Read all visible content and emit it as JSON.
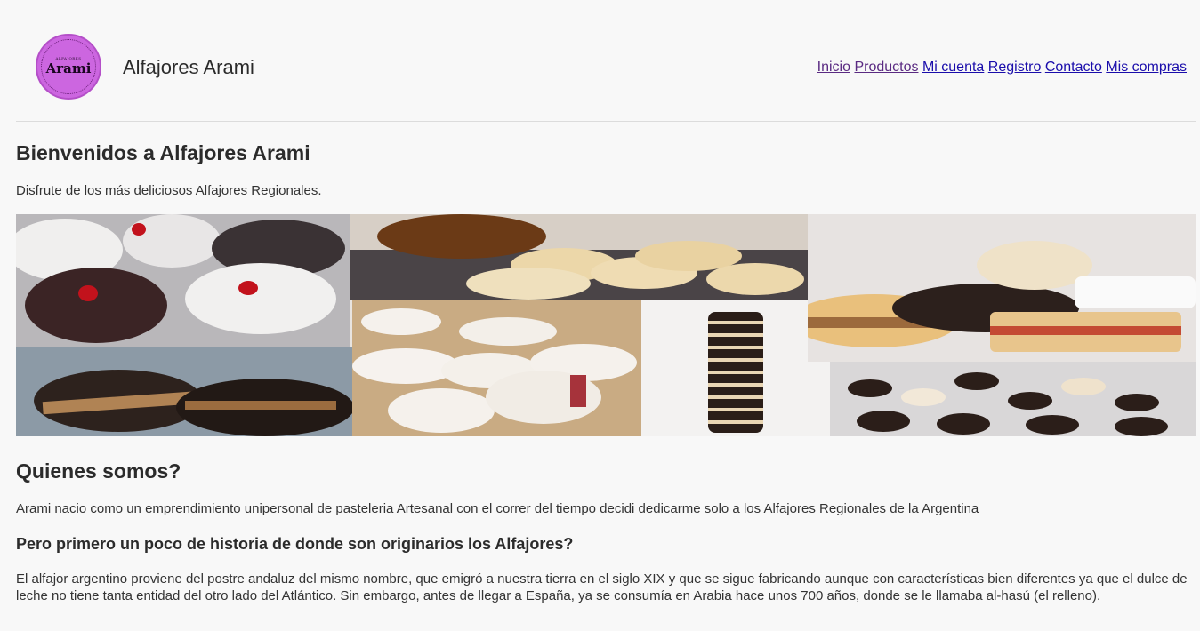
{
  "header": {
    "logo": {
      "small_text": "ALFAJORES",
      "word": "Arami"
    },
    "site_title": "Alfajores Arami",
    "nav": [
      {
        "label": "Inicio"
      },
      {
        "label": "Productos"
      },
      {
        "label": "Mi cuenta"
      },
      {
        "label": "Registro"
      },
      {
        "label": "Contacto"
      },
      {
        "label": "Mis compras"
      }
    ]
  },
  "main": {
    "welcome_heading": "Bienvenidos a Alfajores Arami",
    "welcome_text": "Disfrute de los más deliciosos Alfajores Regionales.",
    "about_heading": "Quienes somos?",
    "about_text": "Arami nacio como un emprendimiento unipersonal de pasteleria Artesanal con el correr del tiempo decidi dedicarme solo a los Alfajores Regionales de la Argentina",
    "history_heading": "Pero primero un poco de historia de donde son originarios los Alfajores?",
    "history_text": "El alfajor argentino proviene del postre andaluz del mismo nombre, que emigró a nuestra tierra en el siglo XIX y que se sigue fabricando aunque con características bien diferentes ya que el dulce de leche no tiene tanta entidad del otro lado del Atlántico. Sin embargo, antes de llegar a España, ya se consumía en Arabia hace unos 700 años, donde se le llamaba al-hasú (el relleno)."
  },
  "colors": {
    "logo_bg": "#cc66e0",
    "link": "#1a0dab",
    "visited_link": "#5a2a82",
    "background": "#f8f8f8"
  }
}
